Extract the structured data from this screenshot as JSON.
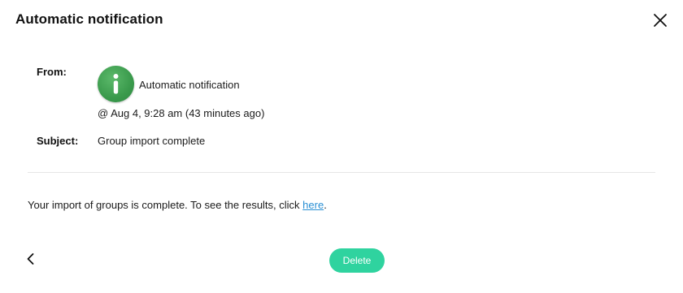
{
  "dialog": {
    "title": "Automatic notification",
    "close_icon": "close-icon"
  },
  "message": {
    "from_label": "From:",
    "sender_name": "Automatic notification",
    "avatar_icon": "info-icon",
    "avatar_color": "#3a9a4c",
    "timestamp": "@ Aug 4, 9:28 am (43 minutes ago)",
    "subject_label": "Subject:",
    "subject": "Group import complete",
    "body_text": "Your import of groups is complete. To see the results, click ",
    "body_link": "here",
    "body_suffix": ".",
    "link_color": "#2a8fd4"
  },
  "footer": {
    "back_icon": "chevron-left-icon",
    "delete_label": "Delete",
    "delete_color": "#2fd39f"
  }
}
